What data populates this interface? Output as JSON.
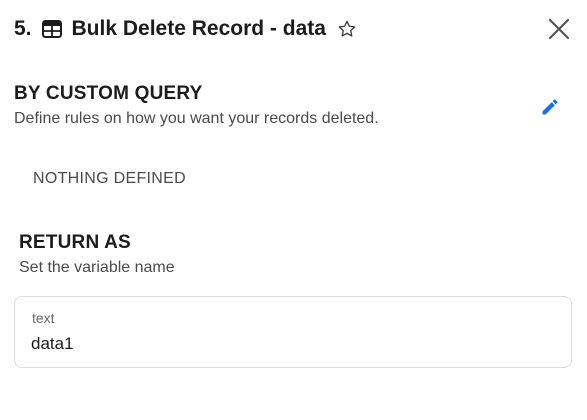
{
  "header": {
    "step_number": "5.",
    "title": "Bulk Delete Record - data"
  },
  "custom_query": {
    "title": "BY CUSTOM QUERY",
    "subtitle": "Define rules on how you want your records deleted.",
    "empty_text": "NOTHING DEFINED"
  },
  "return_as": {
    "title": "RETURN AS",
    "subtitle": "Set the variable name",
    "field_label": "text",
    "field_value": "data1"
  },
  "icons": {
    "table": "table-icon",
    "star": "star-outline-icon",
    "close": "close-icon",
    "edit": "pencil-icon"
  },
  "colors": {
    "accent": "#1f6fe0",
    "text": "#1c1c1e",
    "muted": "#4a4a4f",
    "border": "#dcdce0"
  }
}
